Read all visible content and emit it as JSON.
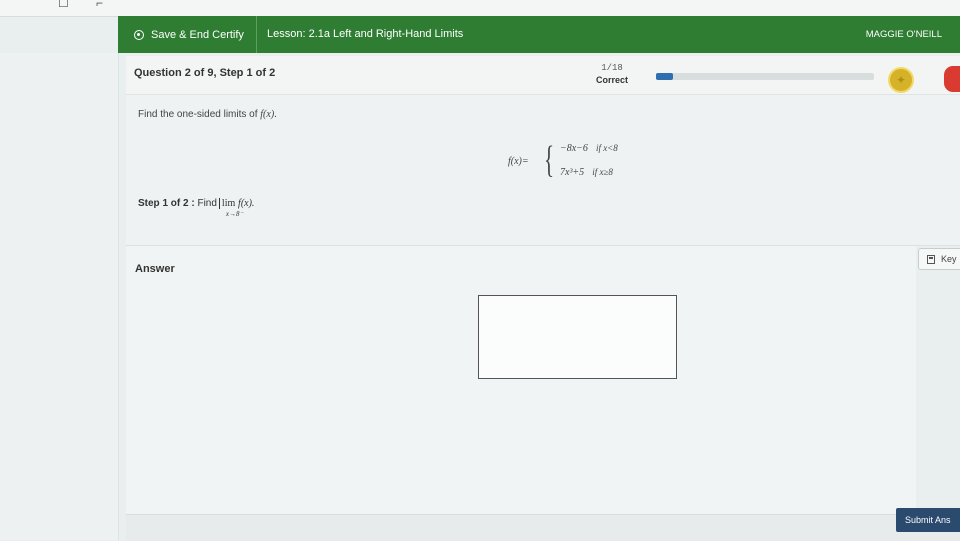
{
  "header": {
    "save_label": "Save & End Certify",
    "lesson_title": "Lesson: 2.1a Left and Right-Hand Limits",
    "user_name": "MAGGIE O'NEILL"
  },
  "question_bar": {
    "title": "Question 2 of 9, Step 1 of 2",
    "score_fraction": "1/18",
    "score_status": "Correct",
    "progress_fraction": 0.08
  },
  "problem": {
    "prompt_text": "Find the one-sided limits of ",
    "prompt_func": "f(x)",
    "prompt_end": ".",
    "piecewise_lhs": "f(x)=",
    "case1_expr": "−8x−6",
    "case1_cond": "if x<8",
    "case2_expr": "7x³+5",
    "case2_cond": "if x≥8",
    "step_label": "Step 1 of 2 :",
    "step_find": "Find",
    "step_lim": "lim",
    "step_lim_sub": "x→8⁻",
    "step_func": "f(x)."
  },
  "answer": {
    "label": "Answer"
  },
  "keypad": {
    "label": "Key"
  },
  "submit": {
    "label": "Submit Ans"
  }
}
